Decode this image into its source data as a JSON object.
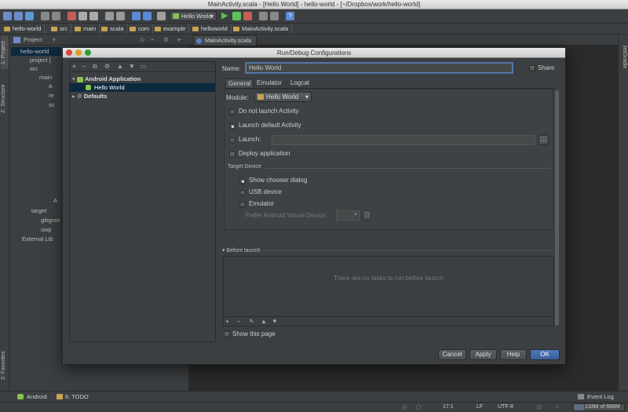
{
  "window": {
    "title": "MainActivity.scala - [Hello World] - hello-world - [~/Dropbox/work/hello-world]"
  },
  "toolbar": {
    "run_config": "Hello World"
  },
  "navbar": {
    "crumbs": [
      "hello-world",
      "src",
      "main",
      "scala",
      "com",
      "example",
      "helloworld",
      "MainActivity.scala"
    ]
  },
  "project_panel": {
    "title": "Project",
    "tree": [
      "hello-world",
      "project [",
      "src",
      "main",
      "a",
      "re",
      "sc",
      "A",
      "target",
      ".gitignor",
      ".swp",
      "External Lib"
    ]
  },
  "editor": {
    "tab": "MainActivity.scala"
  },
  "left_strip": {
    "project": "1: Project",
    "structure": "Z: Structure",
    "favorites": "2: Favorites"
  },
  "right_strip": {
    "gradle": "JetGradle"
  },
  "dialog": {
    "title": "Run/Debug Configurations",
    "left_toolbar": [
      "+",
      "−",
      "⧉",
      "⚙",
      "▲",
      "▼"
    ],
    "tree": {
      "group": "Android Application",
      "item": "Hello World",
      "defaults": "Defaults"
    },
    "name_label": "Name:",
    "name_value": "Hello World",
    "share_label": "Share",
    "tabs": [
      "General",
      "Emulator",
      "Logcat"
    ],
    "module_label": "Module:",
    "module_value": "Hello World",
    "launch_options": [
      "Do not launch Activity",
      "Launch default Activity",
      "Launch:"
    ],
    "deploy_label": "Deploy application",
    "target_header": "Target Device",
    "target_options": [
      "Show chooser dialog",
      "USB device",
      "Emulator"
    ],
    "avd_label": "Prefer Android Virtual Device:",
    "before_launch_header": "Before launch",
    "before_launch_empty": "There are no tasks to run before launch",
    "show_page_label": "Show this page",
    "buttons": {
      "cancel": "Cancel",
      "apply": "Apply",
      "help": "Help",
      "ok": "OK"
    }
  },
  "bottom_tools": {
    "android": "Android",
    "todo": "6: TODO",
    "event_log": "Event Log"
  },
  "status": {
    "position": "17:1",
    "line_sep": "LF",
    "encoding": "UTF-8",
    "memory": "133M of 666M"
  },
  "colors": {
    "accent": "#4d78b8",
    "selection": "#0d293e",
    "bg": "#3c3f41"
  }
}
